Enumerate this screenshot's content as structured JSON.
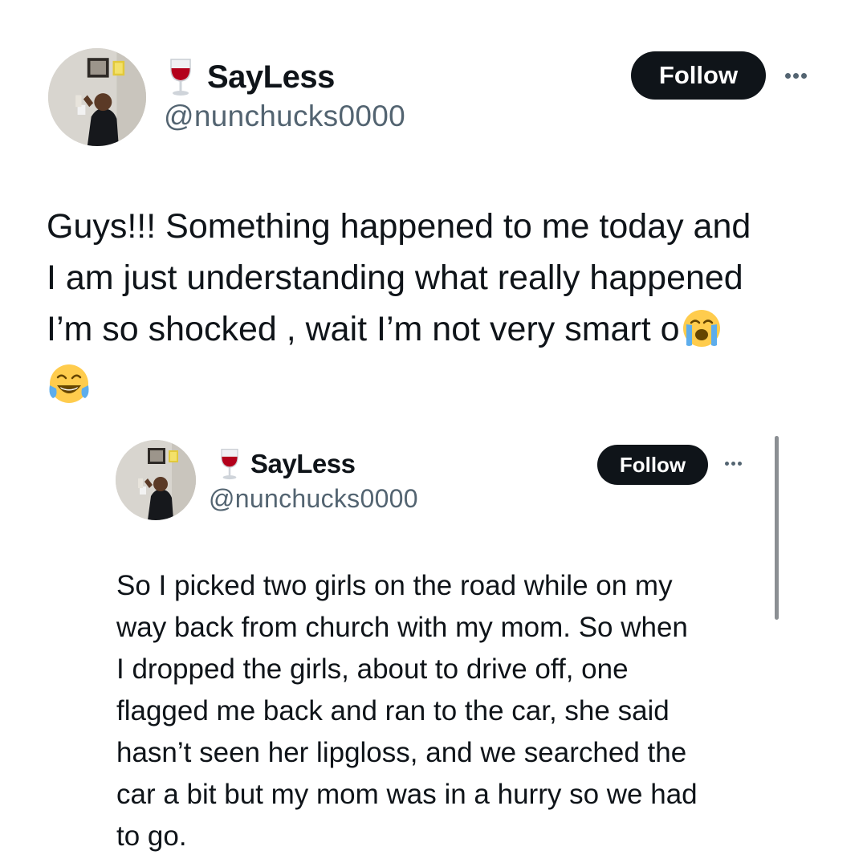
{
  "main_tweet": {
    "author": {
      "display_name": "SayLess",
      "handle": "@nunchucks0000",
      "name_emoji": "wine-glass-icon"
    },
    "follow_label": "Follow",
    "more_icon": "more-options-icon",
    "text_lines": [
      "Guys!!! Something happened to me today and",
      "I am just understanding what really happened",
      "I’m so shocked , wait I’m not very smart o"
    ],
    "emojis": [
      "loudly-crying-face-emoji",
      "face-with-tears-of-joy-emoji"
    ]
  },
  "quoted_tweet": {
    "author": {
      "display_name": "SayLess",
      "handle": "@nunchucks0000",
      "name_emoji": "wine-glass-icon"
    },
    "follow_label": "Follow",
    "more_icon": "more-options-icon",
    "text_lines": [
      "So I picked two girls on the road while on my",
      "way back from church with my mom. So when",
      "I dropped the girls, about to drive off, one",
      "flagged me back and ran to the car, she said",
      "hasn’t seen her lipgloss, and we searched the",
      "car a bit but my mom was in a hurry so we had",
      "to go."
    ]
  },
  "colors": {
    "text_primary": "#0f1419",
    "text_secondary": "#536471",
    "follow_button_bg": "#0f1419",
    "follow_button_text": "#ffffff",
    "scrollbar": "#8b8f93"
  }
}
